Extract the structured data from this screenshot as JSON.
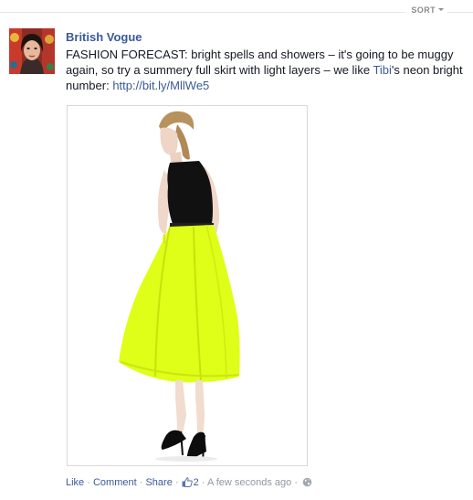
{
  "sort": {
    "label": "SORT",
    "icon": "chevron-down-icon"
  },
  "post": {
    "author": "British Vogue",
    "text_before_link1": "FASHION FORECAST: bright spells and showers – it's going to be muggy again, so try a summery full skirt with light layers – we like ",
    "mention": "Tibi",
    "text_between": "'s neon bright number: ",
    "url": "http://bit.ly/MllWe5",
    "photo_icon": "fashion-photo",
    "skirt_color": "#dfff18"
  },
  "footer": {
    "like": "Like",
    "comment": "Comment",
    "share": "Share",
    "like_count": "2",
    "timestamp": "A few seconds ago",
    "separator": "·",
    "audience_icon": "globe-icon"
  },
  "colors": {
    "link": "#3b5998",
    "meta": "#9197a3",
    "text": "#141823"
  }
}
